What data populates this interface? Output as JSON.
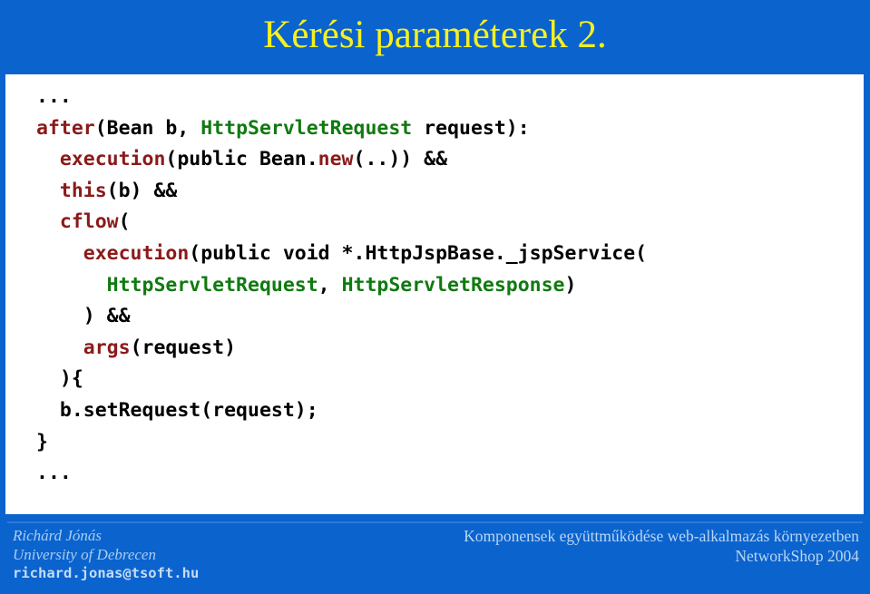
{
  "slide": {
    "title": "Kérési paraméterek 2.",
    "background_color": "#0b63ce",
    "title_color": "#f5f020",
    "panel_color": "#ffffff"
  },
  "code": {
    "language": "AspectJ",
    "keyword_color": "#8b1a1a",
    "type_color": "#107a10",
    "text_color": "#000000",
    "lines": [
      {
        "indent": 0,
        "tokens": [
          {
            "t": "...",
            "c": "plain"
          }
        ]
      },
      {
        "indent": 0,
        "tokens": [
          {
            "t": "after",
            "c": "kw"
          },
          {
            "t": "(Bean b, ",
            "c": "plain"
          },
          {
            "t": "HttpServletRequest",
            "c": "type"
          },
          {
            "t": " request):",
            "c": "plain"
          }
        ]
      },
      {
        "indent": 2,
        "tokens": [
          {
            "t": "execution",
            "c": "kw"
          },
          {
            "t": "(public Bean.",
            "c": "plain"
          },
          {
            "t": "new",
            "c": "kw"
          },
          {
            "t": "(..)) &&",
            "c": "plain"
          }
        ]
      },
      {
        "indent": 2,
        "tokens": [
          {
            "t": "this",
            "c": "kw"
          },
          {
            "t": "(b) &&",
            "c": "plain"
          }
        ]
      },
      {
        "indent": 2,
        "tokens": [
          {
            "t": "cflow",
            "c": "kw"
          },
          {
            "t": "(",
            "c": "plain"
          }
        ]
      },
      {
        "indent": 4,
        "tokens": [
          {
            "t": "execution",
            "c": "kw"
          },
          {
            "t": "(public void *.HttpJspBase._jspService(",
            "c": "plain"
          }
        ]
      },
      {
        "indent": 6,
        "tokens": [
          {
            "t": "HttpServletRequest",
            "c": "type"
          },
          {
            "t": ", ",
            "c": "plain"
          },
          {
            "t": "HttpServletResponse",
            "c": "type"
          },
          {
            "t": ")",
            "c": "plain"
          }
        ]
      },
      {
        "indent": 4,
        "tokens": [
          {
            "t": ") &&",
            "c": "plain"
          }
        ]
      },
      {
        "indent": 4,
        "tokens": [
          {
            "t": "args",
            "c": "kw"
          },
          {
            "t": "(request)",
            "c": "plain"
          }
        ]
      },
      {
        "indent": 2,
        "tokens": [
          {
            "t": "){",
            "c": "plain"
          }
        ]
      },
      {
        "indent": 2,
        "tokens": [
          {
            "t": "b.setRequest(request);",
            "c": "plain"
          }
        ]
      },
      {
        "indent": 0,
        "tokens": [
          {
            "t": "}",
            "c": "plain"
          }
        ]
      },
      {
        "indent": 0,
        "tokens": [
          {
            "t": "...",
            "c": "plain"
          }
        ]
      }
    ]
  },
  "footer": {
    "author_name": "Richárd Jónás",
    "author_org": "University of Debrecen",
    "author_email": "richard.jonas@tsoft.hu",
    "conference_title": "Komponensek együttműködése web-alkalmazás környezetben",
    "conference_event": "NetworkShop 2004"
  }
}
